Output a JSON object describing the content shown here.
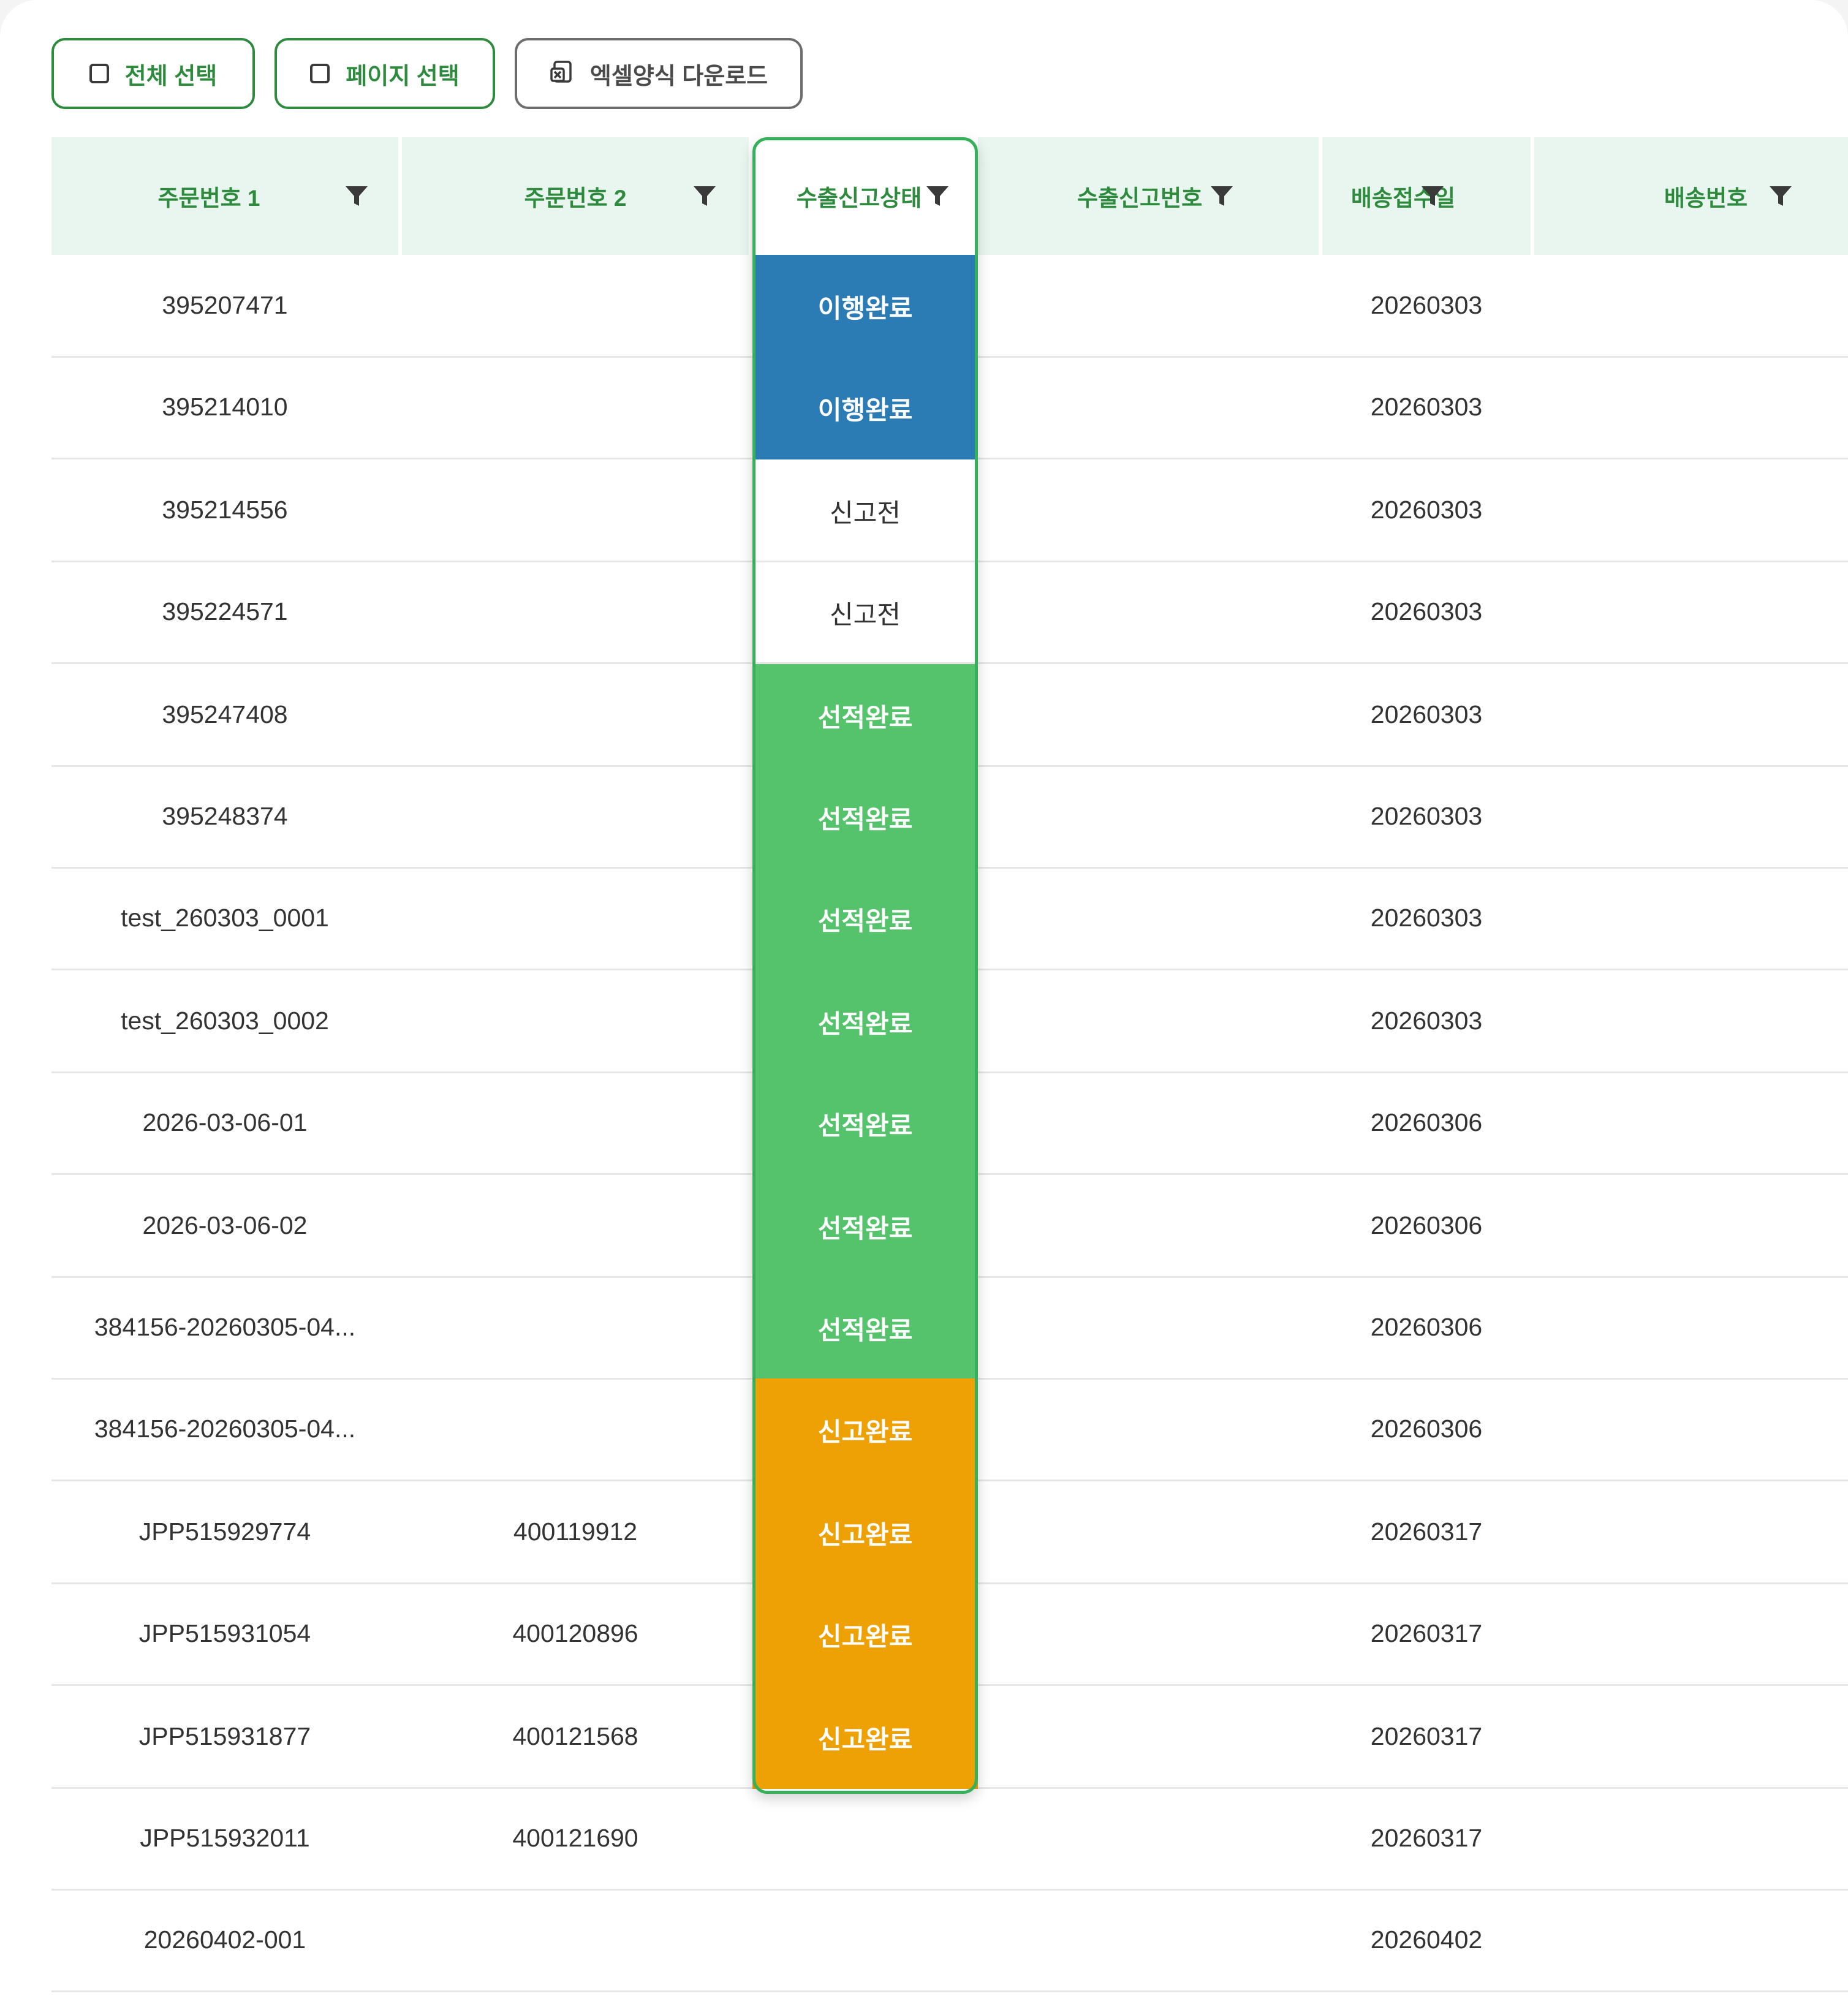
{
  "toolbar": {
    "select_all": "전체 선택",
    "select_page": "페이지 선택",
    "excel_download": "엑셀양식 다운로드"
  },
  "columns": [
    "주문번호 1",
    "주문번호 2",
    "수출신고상태",
    "수출신고번호",
    "배송접수일",
    "배송번호"
  ],
  "status_colors": {
    "이행완료": "#2b7bb5",
    "신고전": "#ffffff",
    "선적완료": "#55c36b",
    "신고완료": "#eda104"
  },
  "rows": [
    {
      "order1": "395207471",
      "order2": "",
      "status": "이행완료",
      "export_no": "",
      "received": "20260303",
      "ship_no": ""
    },
    {
      "order1": "395214010",
      "order2": "",
      "status": "이행완료",
      "export_no": "",
      "received": "20260303",
      "ship_no": ""
    },
    {
      "order1": "395214556",
      "order2": "",
      "status": "신고전",
      "export_no": "",
      "received": "20260303",
      "ship_no": ""
    },
    {
      "order1": "395224571",
      "order2": "",
      "status": "신고전",
      "export_no": "",
      "received": "20260303",
      "ship_no": ""
    },
    {
      "order1": "395247408",
      "order2": "",
      "status": "선적완료",
      "export_no": "",
      "received": "20260303",
      "ship_no": ""
    },
    {
      "order1": "395248374",
      "order2": "",
      "status": "선적완료",
      "export_no": "",
      "received": "20260303",
      "ship_no": ""
    },
    {
      "order1": "test_260303_0001",
      "order2": "",
      "status": "선적완료",
      "export_no": "",
      "received": "20260303",
      "ship_no": ""
    },
    {
      "order1": "test_260303_0002",
      "order2": "",
      "status": "선적완료",
      "export_no": "",
      "received": "20260303",
      "ship_no": ""
    },
    {
      "order1": "2026-03-06-01",
      "order2": "",
      "status": "선적완료",
      "export_no": "",
      "received": "20260306",
      "ship_no": ""
    },
    {
      "order1": "2026-03-06-02",
      "order2": "",
      "status": "선적완료",
      "export_no": "",
      "received": "20260306",
      "ship_no": ""
    },
    {
      "order1": "384156-20260305-04...",
      "order2": "",
      "status": "선적완료",
      "export_no": "",
      "received": "20260306",
      "ship_no": ""
    },
    {
      "order1": "384156-20260305-04...",
      "order2": "",
      "status": "신고완료",
      "export_no": "",
      "received": "20260306",
      "ship_no": ""
    },
    {
      "order1": "JPP515929774",
      "order2": "400119912",
      "status": "신고완료",
      "export_no": "",
      "received": "20260317",
      "ship_no": ""
    },
    {
      "order1": "JPP515931054",
      "order2": "400120896",
      "status": "신고완료",
      "export_no": "",
      "received": "20260317",
      "ship_no": ""
    },
    {
      "order1": "JPP515931877",
      "order2": "400121568",
      "status": "신고완료",
      "export_no": "",
      "received": "20260317",
      "ship_no": ""
    },
    {
      "order1": "JPP515932011",
      "order2": "400121690",
      "status": "",
      "export_no": "",
      "received": "20260317",
      "ship_no": ""
    },
    {
      "order1": "20260402-001",
      "order2": "",
      "status": "",
      "export_no": "",
      "received": "20260402",
      "ship_no": ""
    }
  ]
}
